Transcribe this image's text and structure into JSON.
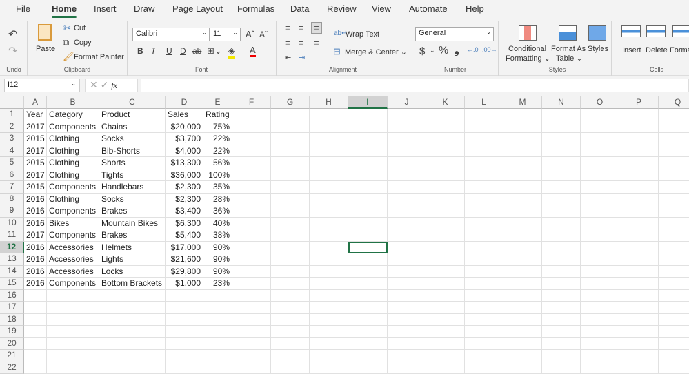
{
  "tabs": [
    "File",
    "Home",
    "Insert",
    "Draw",
    "Page Layout",
    "Formulas",
    "Data",
    "Review",
    "View",
    "Automate",
    "Help"
  ],
  "active_tab": "Home",
  "ribbon": {
    "undo_group": "Undo",
    "clipboard": {
      "paste": "Paste",
      "cut": "Cut",
      "copy": "Copy",
      "format_painter": "Format Painter",
      "group": "Clipboard"
    },
    "font": {
      "name": "Calibri",
      "size": "11",
      "bold": "B",
      "italic": "I",
      "underline": "U",
      "double_underline": "D",
      "strike": "ab",
      "group": "Font"
    },
    "alignment": {
      "wrap_text": "Wrap Text",
      "merge_center": "Merge & Center",
      "group": "Alignment"
    },
    "number": {
      "format": "General",
      "currency": "$",
      "percent": "%",
      "comma": "❟",
      "group": "Number"
    },
    "styles": {
      "conditional_1": "Conditional",
      "conditional_2": "Formatting",
      "format_table_1": "Format As",
      "format_table_2": "Table",
      "styles": "Styles",
      "group": "Styles"
    },
    "cells": {
      "insert": "Insert",
      "delete": "Delete",
      "format": "Format",
      "group": "Cells"
    }
  },
  "formula_bar": {
    "name_box": "I12",
    "fx": "fx",
    "value": ""
  },
  "columns": [
    "A",
    "B",
    "C",
    "D",
    "E",
    "F",
    "G",
    "H",
    "I",
    "J",
    "K",
    "L",
    "M",
    "N",
    "O",
    "P",
    "Q"
  ],
  "selected_cell": "I12",
  "rows": [
    [
      "Year",
      "Category",
      "Product",
      "Sales",
      "Rating"
    ],
    [
      "2017",
      "Components",
      "Chains",
      "$20,000",
      "75%"
    ],
    [
      "2015",
      "Clothing",
      "Socks",
      "$3,700",
      "22%"
    ],
    [
      "2017",
      "Clothing",
      "Bib-Shorts",
      "$4,000",
      "22%"
    ],
    [
      "2015",
      "Clothing",
      "Shorts",
      "$13,300",
      "56%"
    ],
    [
      "2017",
      "Clothing",
      "Tights",
      "$36,000",
      "100%"
    ],
    [
      "2015",
      "Components",
      "Handlebars",
      "$2,300",
      "35%"
    ],
    [
      "2016",
      "Clothing",
      "Socks",
      "$2,300",
      "28%"
    ],
    [
      "2016",
      "Components",
      "Brakes",
      "$3,400",
      "36%"
    ],
    [
      "2016",
      "Bikes",
      "Mountain Bikes",
      "$6,300",
      "40%"
    ],
    [
      "2017",
      "Components",
      "Brakes",
      "$5,400",
      "38%"
    ],
    [
      "2016",
      "Accessories",
      "Helmets",
      "$17,000",
      "90%"
    ],
    [
      "2016",
      "Accessories",
      "Lights",
      "$21,600",
      "90%"
    ],
    [
      "2016",
      "Accessories",
      "Locks",
      "$29,800",
      "90%"
    ],
    [
      "2016",
      "Components",
      "Bottom Brackets",
      "$1,000",
      "23%"
    ]
  ],
  "row_count": 22
}
